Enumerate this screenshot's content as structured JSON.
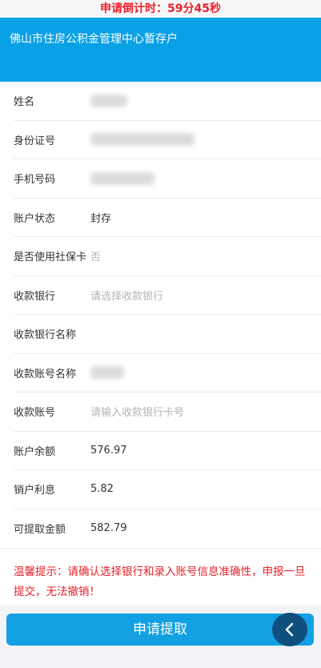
{
  "countdown": "申请倒计时：59分45秒",
  "header": {
    "title": "佛山市住房公积金管理中心暂存户"
  },
  "fields": {
    "name_label": "姓名",
    "id_label": "身份证号",
    "phone_label": "手机号码",
    "status_label": "账户状态",
    "status_value": "封存",
    "social_card_label": "是否使用社保卡",
    "social_card_value": "否",
    "bank_label": "收款银行",
    "bank_placeholder": "请选择收款银行",
    "bank_name_label": "收款银行名称",
    "account_name_label": "收款账号名称",
    "account_label": "收款账号",
    "account_placeholder": "请输入收款银行卡号",
    "balance_label": "账户余额",
    "balance_value": "576.97",
    "interest_label": "销户利息",
    "interest_value": "5.82",
    "withdrawable_label": "可提取金额",
    "withdrawable_value": "582.79"
  },
  "tip": "温馨提示：请确认选择银行和录入账号信息准确性，申报一旦提交，无法撤销！",
  "submit_label": "申请提取",
  "icons": {
    "back": "back-arrow-icon"
  },
  "colors": {
    "accent": "#0aa0e6",
    "warning": "#e8222a",
    "button": "#13a0e2"
  }
}
